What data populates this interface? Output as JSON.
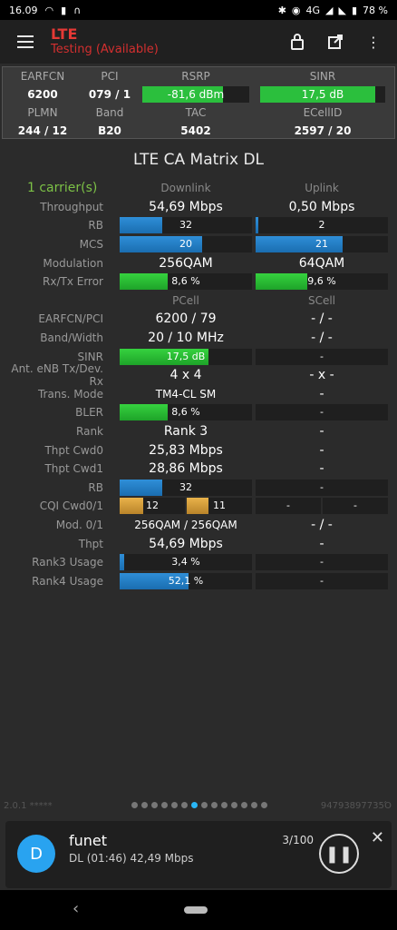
{
  "status": {
    "time": "16.09",
    "icons": [
      "wifi-icon",
      "signal-icon",
      "headphones-icon"
    ],
    "right_icons": [
      "bluetooth-icon",
      "location-icon",
      "4g-icon",
      "signal-icon",
      "wifi-off-icon",
      "battery-icon"
    ],
    "battery": "78 %"
  },
  "app": {
    "title": "LTE",
    "subtitle": "Testing (Available)"
  },
  "summary": {
    "labels_row1": [
      "EARFCN",
      "PCI",
      "RSRP",
      "SINR"
    ],
    "values_row1": [
      "6200",
      "079 / 1",
      "-81,6 dBm",
      "17,5 dB"
    ],
    "labels_row2": [
      "PLMN",
      "Band",
      "TAC",
      "ECellID"
    ],
    "values_row2": [
      "244 / 12",
      "B20",
      "5402",
      "2597 / 20"
    ],
    "rsrp_fill": 0.75,
    "sinr_fill": 0.92
  },
  "main_title": "LTE CA Matrix DL",
  "carriers": "1 carrier(s)",
  "headers": {
    "dl": "Downlink",
    "ul": "Uplink",
    "pcell": "PCell",
    "scell": "SCell"
  },
  "rows": {
    "throughput": {
      "label": "Throughput",
      "dl": "54,69 Mbps",
      "ul": "0,50 Mbps"
    },
    "rb": {
      "label": "RB",
      "dl": "32",
      "ul": "2",
      "dl_fill": 0.32,
      "ul_fill": 0.02
    },
    "mcs": {
      "label": "MCS",
      "dl": "20",
      "ul": "21",
      "dl_fill": 0.62,
      "ul_fill": 0.66
    },
    "modulation": {
      "label": "Modulation",
      "dl": "256QAM",
      "ul": "64QAM"
    },
    "rxtx": {
      "label": "Rx/Tx Error",
      "dl": "8,6 %",
      "ul": "9,6 %",
      "dl_fill": 0.36,
      "ul_fill": 0.39
    },
    "earfcn": {
      "label": "EARFCN/PCI",
      "p": "6200 / 79",
      "s": "- / -"
    },
    "bw": {
      "label": "Band/Width",
      "p": "20 / 10 MHz",
      "s": "- / -"
    },
    "sinr": {
      "label": "SINR",
      "p": "17,5 dB",
      "s": "-",
      "p_fill": 0.67
    },
    "ant": {
      "label": "Ant. eNB Tx/Dev. Rx",
      "p": "4 x 4",
      "s": "- x -"
    },
    "tm": {
      "label": "Trans. Mode",
      "p": "TM4-CL SM",
      "s": "-"
    },
    "bler": {
      "label": "BLER",
      "p": "8,6 %",
      "s": "-",
      "p_fill": 0.36
    },
    "rank": {
      "label": "Rank",
      "p": "Rank 3",
      "s": "-"
    },
    "thpt0": {
      "label": "Thpt Cwd0",
      "p": "25,83 Mbps",
      "s": "-"
    },
    "thpt1": {
      "label": "Thpt Cwd1",
      "p": "28,86 Mbps",
      "s": "-"
    },
    "rb2": {
      "label": "RB",
      "p": "32",
      "s": "-",
      "p_fill": 0.32
    },
    "cqi": {
      "label": "CQI Cwd0/1",
      "p0": "12",
      "p1": "11",
      "s0": "-",
      "s1": "-",
      "p0_fill": 0.8,
      "p1_fill": 0.73
    },
    "mod01": {
      "label": "Mod. 0/1",
      "p": "256QAM / 256QAM",
      "s": "- / -"
    },
    "thpt": {
      "label": "Thpt",
      "p": "54,69 Mbps",
      "s": "-"
    },
    "rank3": {
      "label": "Rank3 Usage",
      "p": "3,4 %",
      "s": "-",
      "p_fill": 0.034
    },
    "rank4": {
      "label": "Rank4 Usage",
      "p": "52,1 %",
      "s": "-",
      "p_fill": 0.521
    }
  },
  "pager": {
    "version": "2.0.1 *****",
    "id": "94793897735Ό",
    "pages": 14,
    "active": 6
  },
  "notification": {
    "avatar": "D",
    "name": "funet",
    "detail": "DL (01:46) 42,49 Mbps",
    "count": "3/100"
  }
}
